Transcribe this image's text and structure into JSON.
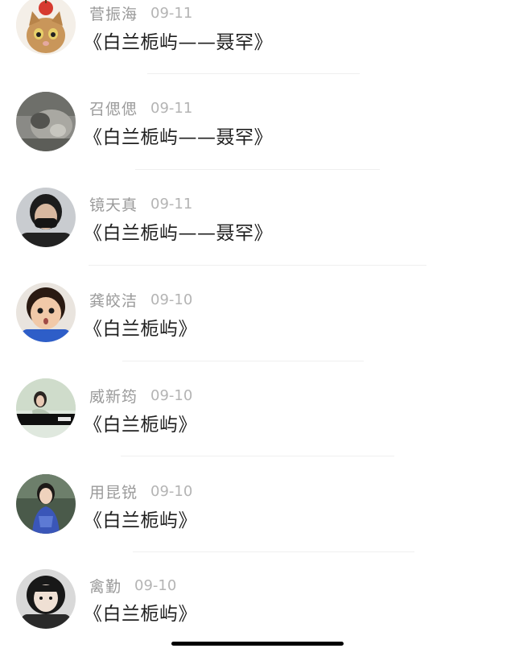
{
  "comments": [
    {
      "name": "菅振海",
      "date": "09-11",
      "title": "《白兰栀屿——聂罕》",
      "avatar": "avatar-cat-with-apple"
    },
    {
      "name": "召偲偲",
      "date": "09-11",
      "title": "《白兰栀屿——聂罕》",
      "avatar": "avatar-grey-animal"
    },
    {
      "name": "镜天真",
      "date": "09-11",
      "title": "《白兰栀屿——聂罕》",
      "avatar": "avatar-masked-man"
    },
    {
      "name": "龚皎洁",
      "date": "09-10",
      "title": "《白兰栀屿》",
      "avatar": "avatar-surprised-child"
    },
    {
      "name": "威新筠",
      "date": "09-10",
      "title": "《白兰栀屿》",
      "avatar": "avatar-woman-photo"
    },
    {
      "name": "用昆锐",
      "date": "09-10",
      "title": "《白兰栀屿》",
      "avatar": "avatar-woman-blue-dress"
    },
    {
      "name": "禽勤",
      "date": "09-10",
      "title": "《白兰栀屿》",
      "avatar": "avatar-dark-hair-woman"
    }
  ]
}
